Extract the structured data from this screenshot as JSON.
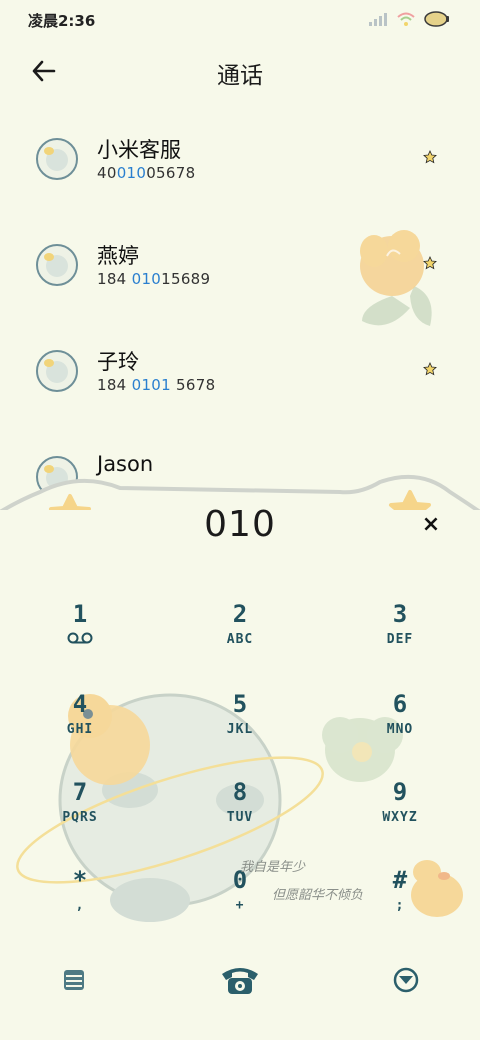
{
  "status_bar": {
    "time": "凌晨2:36",
    "icons": [
      "signal-icon",
      "wifi-icon",
      "battery-icon"
    ]
  },
  "header": {
    "title": "通话",
    "back_icon": "back-arrow-icon"
  },
  "contacts": [
    {
      "name": "小米客服",
      "number_parts": [
        "40",
        "010",
        "05678"
      ],
      "starred": true
    },
    {
      "name": "燕婷",
      "number_parts": [
        "184 ",
        "010",
        "15689"
      ],
      "starred": true
    },
    {
      "name": "子玲",
      "number_parts": [
        "184 ",
        "0101",
        " 5678"
      ],
      "starred": true
    },
    {
      "name": "Jason",
      "number_parts": [],
      "starred": true
    }
  ],
  "dialpad": {
    "input": "010",
    "clear_label": "×",
    "keys": [
      {
        "digit": "1",
        "letters": ""
      },
      {
        "digit": "2",
        "letters": "ABC"
      },
      {
        "digit": "3",
        "letters": "DEF"
      },
      {
        "digit": "4",
        "letters": "GHI"
      },
      {
        "digit": "5",
        "letters": "JKL"
      },
      {
        "digit": "6",
        "letters": "MNO"
      },
      {
        "digit": "7",
        "letters": "PQRS"
      },
      {
        "digit": "8",
        "letters": "TUV"
      },
      {
        "digit": "9",
        "letters": "WXYZ"
      },
      {
        "digit": "*",
        "letters": ","
      },
      {
        "digit": "0",
        "letters": "+"
      },
      {
        "digit": "#",
        "letters": ";"
      }
    ],
    "voicemail_icon": "voicemail-icon",
    "slogan_line1": "我自是年少",
    "slogan_line2": "但愿韶华不倾负"
  },
  "bottom_bar": {
    "left_icon": "menu-icon",
    "center_icon": "phone-dial-icon",
    "right_icon": "collapse-keypad-icon"
  },
  "colors": {
    "background": "#f7f9ea",
    "key_text": "#22525e",
    "highlight": "#2a7fcf",
    "star": "#f2d56b"
  }
}
